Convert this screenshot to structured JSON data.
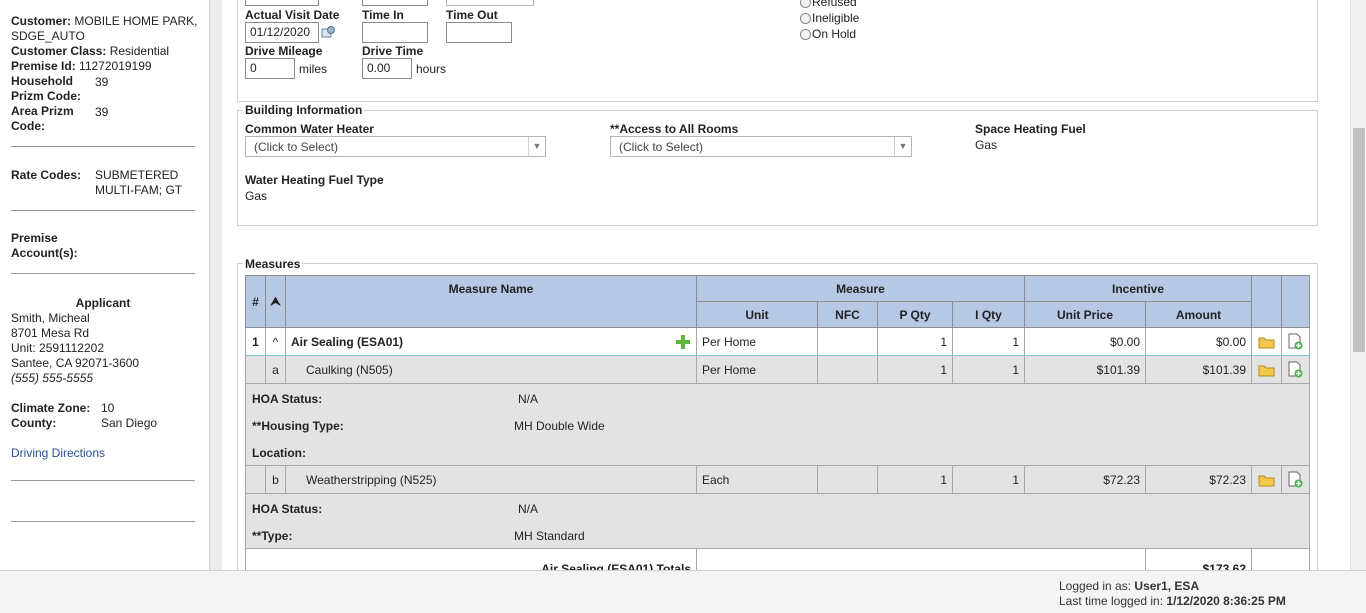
{
  "sidebar": {
    "customer_label": "Customer:",
    "customer_value": "MOBILE HOME PARK, SDGE_AUTO",
    "customer_class_label": "Customer Class:",
    "customer_class_value": "Residential",
    "premise_id_label": "Premise Id:",
    "premise_id_value": "11272019199",
    "household_prizm_label": "Household Prizm Code:",
    "household_prizm_value": "39",
    "area_prizm_label": "Area Prizm Code:",
    "area_prizm_value": "39",
    "rate_codes_label": "Rate Codes:",
    "rate_codes_value": "SUBMETERED MULTI-FAM; GT",
    "premise_accounts_label": "Premise Account(s):",
    "applicant_heading": "Applicant",
    "applicant_name": "Smith, Micheal",
    "applicant_address": "8701 Mesa Rd",
    "applicant_unit_label": "Unit:",
    "applicant_unit": "2591112202",
    "applicant_city": "Santee, CA 92071-3600",
    "applicant_phone": "(555) 555-5555",
    "climate_zone_label": "Climate Zone:",
    "climate_zone_value": "10",
    "county_label": "County:",
    "county_value": "San Diego",
    "driving_directions": "Driving Directions"
  },
  "visit": {
    "actual_visit_date_label": "Actual Visit Date",
    "actual_visit_date_value": "01/12/2020",
    "time_in_label": "Time In",
    "time_in_value": "",
    "time_out_label": "Time Out",
    "time_out_value": "",
    "drive_mileage_label": "Drive Mileage",
    "drive_mileage_value": "0",
    "miles_unit": "miles",
    "drive_time_label": "Drive Time",
    "drive_time_value": "0.00",
    "hours_unit": "hours",
    "radio_refused": "Refused",
    "radio_ineligible": "Ineligible",
    "radio_on_hold": "On Hold"
  },
  "building": {
    "legend": "Building Information",
    "common_water_heater_label": "Common Water Heater",
    "common_water_heater_value": "(Click to Select)",
    "access_all_rooms_label": "**Access to All Rooms",
    "access_all_rooms_value": "(Click to Select)",
    "space_heating_fuel_label": "Space Heating Fuel",
    "space_heating_fuel_value": "Gas",
    "water_heating_fuel_label": "Water Heating Fuel Type",
    "water_heating_fuel_value": "Gas"
  },
  "measures": {
    "legend": "Measures",
    "headers": {
      "num": "#",
      "sort": "⮝",
      "measure_name": "Measure Name",
      "measure_group": "Measure",
      "incentive_group": "Incentive",
      "unit": "Unit",
      "nfc": "NFC",
      "p_qty": "P Qty",
      "i_qty": "I Qty",
      "unit_price": "Unit Price",
      "amount": "Amount"
    },
    "row1": {
      "num": "1",
      "toggle": "^",
      "name": "Air Sealing (ESA01)",
      "unit": "Per Home",
      "nfc": "",
      "p_qty": "1",
      "i_qty": "1",
      "unit_price": "$0.00",
      "amount": "$0.00"
    },
    "row_a": {
      "letter": "a",
      "name": "Caulking (N505)",
      "unit": "Per Home",
      "nfc": "",
      "p_qty": "1",
      "i_qty": "1",
      "unit_price": "$101.39",
      "amount": "$101.39"
    },
    "row_a_details": {
      "hoa_label": "HOA Status:",
      "hoa_value": "N/A",
      "housing_label": "**Housing Type:",
      "housing_value": "MH Double Wide",
      "location_label": "Location:"
    },
    "row_b": {
      "letter": "b",
      "name": "Weatherstripping (N525)",
      "unit": "Each",
      "nfc": "",
      "p_qty": "1",
      "i_qty": "1",
      "unit_price": "$72.23",
      "amount": "$72.23"
    },
    "row_b_details": {
      "hoa_label": "HOA Status:",
      "hoa_value": "N/A",
      "type_label": "**Type:",
      "type_value": "MH Standard"
    },
    "totals_label": "Air Sealing (ESA01) Totals",
    "totals_amount": "$173.62"
  },
  "footer": {
    "logged_in_label": "Logged in as:",
    "logged_in_user": "User1, ESA",
    "last_time_label": "Last time logged in:",
    "last_time_value": "1/12/2020 8:36:25 PM"
  },
  "colors": {
    "table_header": "#b6c8e4",
    "link": "#2a4f96",
    "row_highlight": "#7fc3d8"
  }
}
